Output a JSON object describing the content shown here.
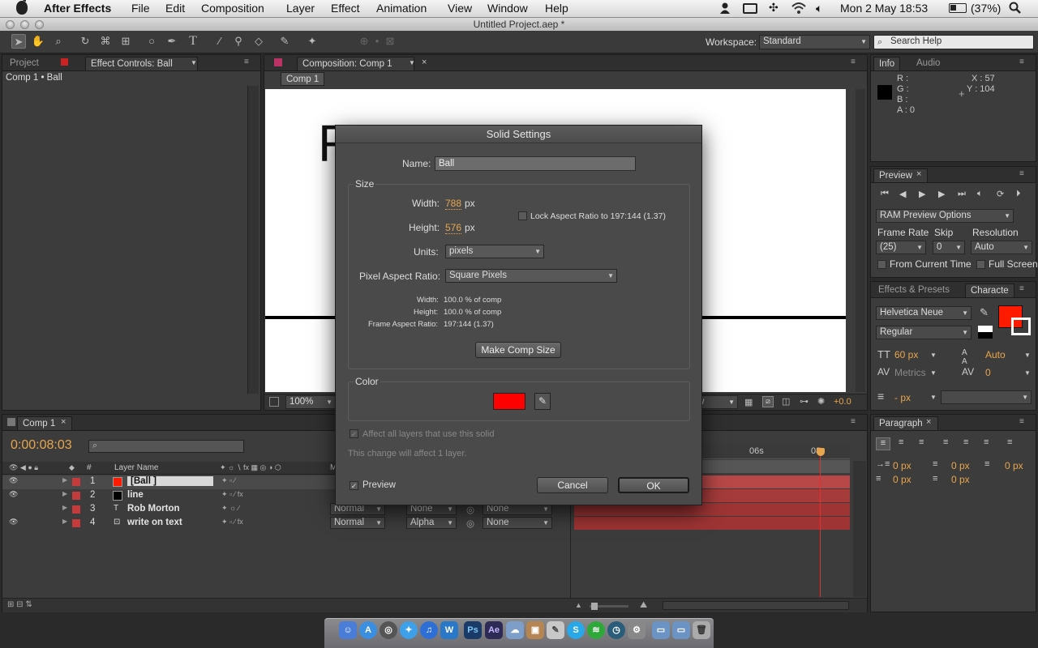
{
  "menubar": {
    "app": "After Effects",
    "items": [
      "File",
      "Edit",
      "Composition",
      "Layer",
      "Effect",
      "Animation",
      "View",
      "Window",
      "Help"
    ],
    "clock": "Mon 2 May  18:53",
    "battery": "(37%)"
  },
  "window": {
    "title": "Untitled Project.aep *"
  },
  "toolbar": {
    "workspace_label": "Workspace:",
    "workspace_value": "Standard",
    "search_placeholder": "Search Help"
  },
  "left_panel": {
    "tab_project": "Project",
    "tab_effect_controls": "Effect Controls: Ball",
    "breadcrumb": "Comp 1 • Ball"
  },
  "comp_panel": {
    "tab": "Composition: Comp 1",
    "subtab": "Comp 1",
    "zoom": "100%",
    "view_partial": "iew",
    "exposure": "+0.0"
  },
  "info_panel": {
    "tab_info": "Info",
    "tab_audio": "Audio",
    "r": "R :",
    "g": "G :",
    "b": "B :",
    "a": "A : 0",
    "x": "X : 57",
    "y": "Y : 104"
  },
  "preview_panel": {
    "tab": "Preview",
    "ram_options": "RAM Preview Options",
    "frame_rate_label": "Frame Rate",
    "skip_label": "Skip",
    "resolution_label": "Resolution",
    "frame_rate": "(25)",
    "skip": "0",
    "resolution": "Auto",
    "from_current_time": "From Current Time",
    "full_screen": "Full Screen"
  },
  "character_panel": {
    "tab_effects": "Effects & Presets",
    "tab_character": "Characte",
    "font": "Helvetica Neue",
    "style": "Regular",
    "size": "60 px",
    "leading": "Auto",
    "kerning": "Metrics",
    "tracking": "0",
    "stroke": "- px",
    "fill_color": "#ff1a00"
  },
  "paragraph_panel": {
    "tab": "Paragraph",
    "indent_left": "0 px",
    "indent_first": "0 px",
    "indent_right": "0 px",
    "space_before": "0 px",
    "space_after": "0 px"
  },
  "timeline": {
    "tab": "Comp 1",
    "timecode": "0:00:08:03",
    "col_num": "#",
    "col_layer_name": "Layer Name",
    "col_mode_partial": "M",
    "ruler_06s": "06s",
    "ruler_08": "08",
    "layers": [
      {
        "num": "1",
        "name": "[Ball ]",
        "color": "#ff1a00",
        "mode": "",
        "trkmat": "",
        "parent": ""
      },
      {
        "num": "2",
        "name": "line",
        "color": "#000000",
        "mode": "",
        "trkmat": "",
        "parent": ""
      },
      {
        "num": "3",
        "name": "Rob Morton",
        "color": "",
        "mode": "Normal",
        "trkmat": "None",
        "parent": "None"
      },
      {
        "num": "4",
        "name": "write on text",
        "color": "",
        "mode": "Normal",
        "trkmat": "Alpha",
        "parent": "None"
      }
    ]
  },
  "dialog": {
    "title": "Solid Settings",
    "name_label": "Name:",
    "name_value": "Ball",
    "size_group": "Size",
    "width_label": "Width:",
    "width_value": "788",
    "height_label": "Height:",
    "height_value": "576",
    "px": "px",
    "lock_aspect": "Lock Aspect Ratio to 197:144 (1.37)",
    "units_label": "Units:",
    "units_value": "pixels",
    "par_label": "Pixel Aspect Ratio:",
    "par_value": "Square Pixels",
    "info_width_label": "Width:",
    "info_width_value": "100.0 % of comp",
    "info_height_label": "Height:",
    "info_height_value": "100.0 % of comp",
    "info_far_label": "Frame Aspect Ratio:",
    "info_far_value": "197:144 (1.37)",
    "make_comp_size": "Make Comp Size",
    "color_group": "Color",
    "color_value": "#ff0000",
    "affect_all": "Affect all layers that use this solid",
    "change_note": "This change will affect 1 layer.",
    "preview": "Preview",
    "cancel": "Cancel",
    "ok": "OK"
  }
}
